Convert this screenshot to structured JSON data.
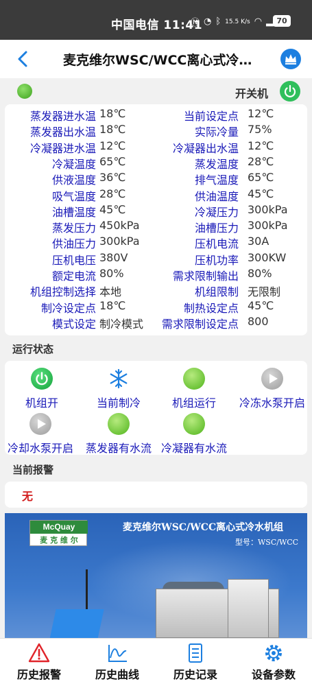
{
  "status_bar": {
    "carrier_time": "中国电信 11:41",
    "network_speed": "15.5 K/s",
    "battery": "70"
  },
  "header": {
    "title": "麦克维尔WSC/WCC离心式冷…"
  },
  "switch": {
    "label": "开关机"
  },
  "parameters": [
    {
      "label1": "蒸发器进水温",
      "value1": "18℃",
      "label2": "当前设定点",
      "value2": "12℃"
    },
    {
      "label1": "蒸发器出水温",
      "value1": "18℃",
      "label2": "实际冷量",
      "value2": "75%"
    },
    {
      "label1": "冷凝器进水温",
      "value1": "12℃",
      "label2": "冷凝器出水温",
      "value2": "12℃"
    },
    {
      "label1": "冷凝温度",
      "value1": "65℃",
      "label2": "蒸发温度",
      "value2": "28℃"
    },
    {
      "label1": "供液温度",
      "value1": "36℃",
      "label2": "排气温度",
      "value2": "65℃"
    },
    {
      "label1": "吸气温度",
      "value1": "28℃",
      "label2": "供油温度",
      "value2": "45℃"
    },
    {
      "label1": "油槽温度",
      "value1": "45℃",
      "label2": "冷凝压力",
      "value2": "300kPa"
    },
    {
      "label1": "蒸发压力",
      "value1": "450kPa",
      "label2": "油槽压力",
      "value2": "300kPa"
    },
    {
      "label1": "供油压力",
      "value1": "300kPa",
      "label2": "压机电流",
      "value2": "30A"
    },
    {
      "label1": "压机电压",
      "value1": "380V",
      "label2": "压机功率",
      "value2": "300KW"
    },
    {
      "label1": "额定电流",
      "value1": "80%",
      "label2": "需求限制输出",
      "value2": "80%"
    },
    {
      "label1": "机组控制选择",
      "value1": "本地",
      "label2": "机组限制",
      "value2": "无限制"
    },
    {
      "label1": "制冷设定点",
      "value1": "18℃",
      "label2": "制热设定点",
      "value2": "45℃"
    },
    {
      "label1": "模式设定",
      "value1": "制冷模式",
      "label2": "需求限制设定点",
      "value2": "800"
    }
  ],
  "running_status": {
    "title": "运行状态",
    "items": [
      {
        "label": "机组开",
        "icon": "power-icon"
      },
      {
        "label": "当前制冷",
        "icon": "snowflake-icon"
      },
      {
        "label": "机组运行",
        "icon": "green-status-icon"
      },
      {
        "label": "冷冻水泵开启",
        "icon": "gray-play-icon"
      },
      {
        "label": "冷却水泵开启",
        "icon": "gray-play-icon"
      },
      {
        "label": "蒸发器有水流",
        "icon": "green-status-icon"
      },
      {
        "label": "冷凝器有水流",
        "icon": "green-status-icon"
      }
    ]
  },
  "alarm": {
    "title": "当前报警",
    "value": "无"
  },
  "banner": {
    "logo_top": "McQuay",
    "logo_bottom": "麦 克 维 尔",
    "title": "麦克维尔WSC/WCC离心式冷水机组",
    "model": "型号：WSC/WCC"
  },
  "bottom_nav": [
    {
      "label": "历史报警",
      "icon": "warning-icon"
    },
    {
      "label": "历史曲线",
      "icon": "chart-icon"
    },
    {
      "label": "历史记录",
      "icon": "document-icon"
    },
    {
      "label": "设备参数",
      "icon": "gear-icon"
    }
  ],
  "colors": {
    "label_blue": "#1a1ab8",
    "accent_blue": "#1c7fe0",
    "power_green": "#2fbf5b",
    "alarm_red": "#d21c1c"
  }
}
